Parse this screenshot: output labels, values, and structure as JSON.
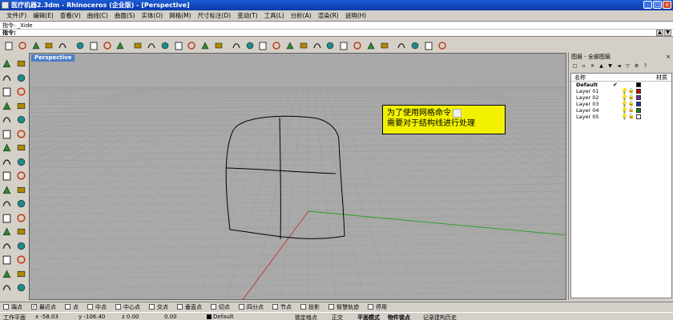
{
  "window": {
    "title": "医疗机器2.3dm - Rhinoceros (企业版) - [Perspective]"
  },
  "menu": [
    "文件(F)",
    "编辑(E)",
    "查看(V)",
    "曲线(C)",
    "曲面(S)",
    "实体(O)",
    "网格(M)",
    "尺寸标注(D)",
    "变动(T)",
    "工具(L)",
    "分析(A)",
    "渲染(R)",
    "说明(H)"
  ],
  "command": {
    "history": "指令: _Xide",
    "prompt_label": "指令:",
    "value": ""
  },
  "toolbar_icons": [
    "new-file-icon",
    "open-folder-icon",
    "save-icon",
    "print-icon",
    "import-icon",
    "cut-icon",
    "copy-icon",
    "paste-icon",
    "undo-icon",
    "pan-hand-icon",
    "rotate-view-icon",
    "zoom-icon",
    "zoom-window-icon",
    "zoom-extents-icon",
    "zoom-selected-icon",
    "rotate-icon",
    "four-viewports-icon",
    "grid-icon",
    "hide-icon",
    "show-icon",
    "lock-icon",
    "light-bulb-icon",
    "layer-icon",
    "properties-icon",
    "material-icon",
    "shade-icon",
    "render-sphere-icon",
    "render-icon",
    "brush-icon",
    "gear-icon",
    "osnap-icon",
    "options-icon"
  ],
  "left_tools": [
    "select-arrow-icon",
    "point-icon",
    "polyline-icon",
    "curve-icon",
    "circle-icon",
    "arc-icon",
    "ellipse-icon",
    "rectangle-icon",
    "polygon-icon",
    "fillet-curve-icon",
    "curve-from-objects-icon",
    "extrude-icon",
    "surface-icon",
    "network-surface-icon",
    "box-icon",
    "sphere-icon",
    "cylinder-icon",
    "boolean-icon",
    "mesh-icon",
    "explode-icon",
    "join-icon",
    "trim-icon",
    "split-icon",
    "scale-icon",
    "move-icon",
    "array-icon",
    "mirror-icon",
    "rotate-3d-icon",
    "text-icon",
    "dimension-icon",
    "block-icon",
    "analyze-icon",
    "render-tool-icon",
    "camera-icon"
  ],
  "viewport": {
    "name": "Perspective",
    "tip_line1": "为了使用网格命令",
    "tip_line2": "需要对于结构线进行处理"
  },
  "layers_panel": {
    "title": "图层 - 全部图层",
    "close": "×",
    "col_name": "名称",
    "col_material": "材质",
    "rows": [
      {
        "name": "Default",
        "current": true,
        "check": "✔",
        "color": "#000000"
      },
      {
        "name": "Layer 01",
        "color": "#cc0000"
      },
      {
        "name": "Layer 02",
        "color": "#7a2a9a"
      },
      {
        "name": "Layer 03",
        "color": "#1f2faa"
      },
      {
        "name": "Layer 04",
        "color": "#1a7a1a"
      },
      {
        "name": "Layer 05",
        "color": "#ffffff"
      }
    ]
  },
  "osnaps": [
    {
      "label": "端点",
      "checked": false
    },
    {
      "label": "最近点",
      "checked": true
    },
    {
      "label": "点",
      "checked": false
    },
    {
      "label": "中点",
      "checked": false
    },
    {
      "label": "中心点",
      "checked": false
    },
    {
      "label": "交点",
      "checked": false
    },
    {
      "label": "垂直点",
      "checked": false
    },
    {
      "label": "切点",
      "checked": false
    },
    {
      "label": "四分点",
      "checked": false
    },
    {
      "label": "节点",
      "checked": false
    },
    {
      "label": "投影",
      "checked": false
    },
    {
      "label": "智慧轨迹",
      "checked": false
    },
    {
      "label": "停用",
      "checked": false
    }
  ],
  "status": {
    "cplane": "工作平面",
    "x": "x -58.03",
    "y": "y -106.40",
    "z": "z 0.00",
    "dist": "0.00",
    "layer": "Default",
    "snap": "锁定格点",
    "ortho": "正交",
    "planar": "平面模式",
    "osnap": "物件锁点",
    "history": "记录建构历史"
  },
  "colors": {
    "viewport_bg": "#a9a9a9",
    "x_axis": "#c03030",
    "y_axis": "#20a020",
    "tip_bg": "#f2f200",
    "titlebar": "#0a3aa8"
  }
}
